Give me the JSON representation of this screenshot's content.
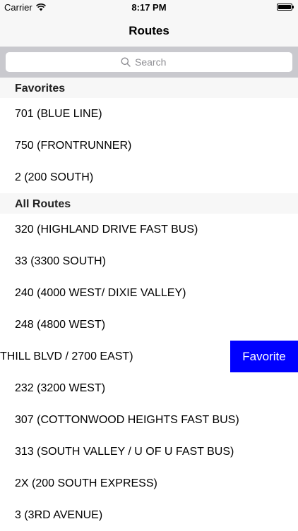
{
  "status_bar": {
    "carrier": "Carrier",
    "time": "8:17 PM"
  },
  "nav": {
    "title": "Routes"
  },
  "search": {
    "placeholder": "Search"
  },
  "sections": [
    {
      "title": "Favorites",
      "rows": [
        "701 (BLUE LINE)",
        "750 (FRONTRUNNER)",
        "2 (200 SOUTH)"
      ]
    },
    {
      "title": "All Routes",
      "rows": [
        "320 (HIGHLAND DRIVE FAST BUS)",
        "33 (3300 SOUTH)",
        "240 (4000 WEST/ DIXIE VALLEY)",
        "248 (4800 WEST)"
      ],
      "swiped_row": {
        "visible_text": "THILL BLVD / 2700 EAST)",
        "action_label": "Favorite"
      },
      "rows_after": [
        "232 (3200 WEST)",
        "307 (COTTONWOOD HEIGHTS FAST BUS)",
        "313 (SOUTH VALLEY / U OF U FAST BUS)",
        "2X (200 SOUTH EXPRESS)",
        "3 (3RD AVENUE)"
      ]
    }
  ],
  "colors": {
    "favorite_action": "#0000ff",
    "section_header_bg": "#f7f7f7",
    "search_bar_bg": "#c9c9ce"
  }
}
